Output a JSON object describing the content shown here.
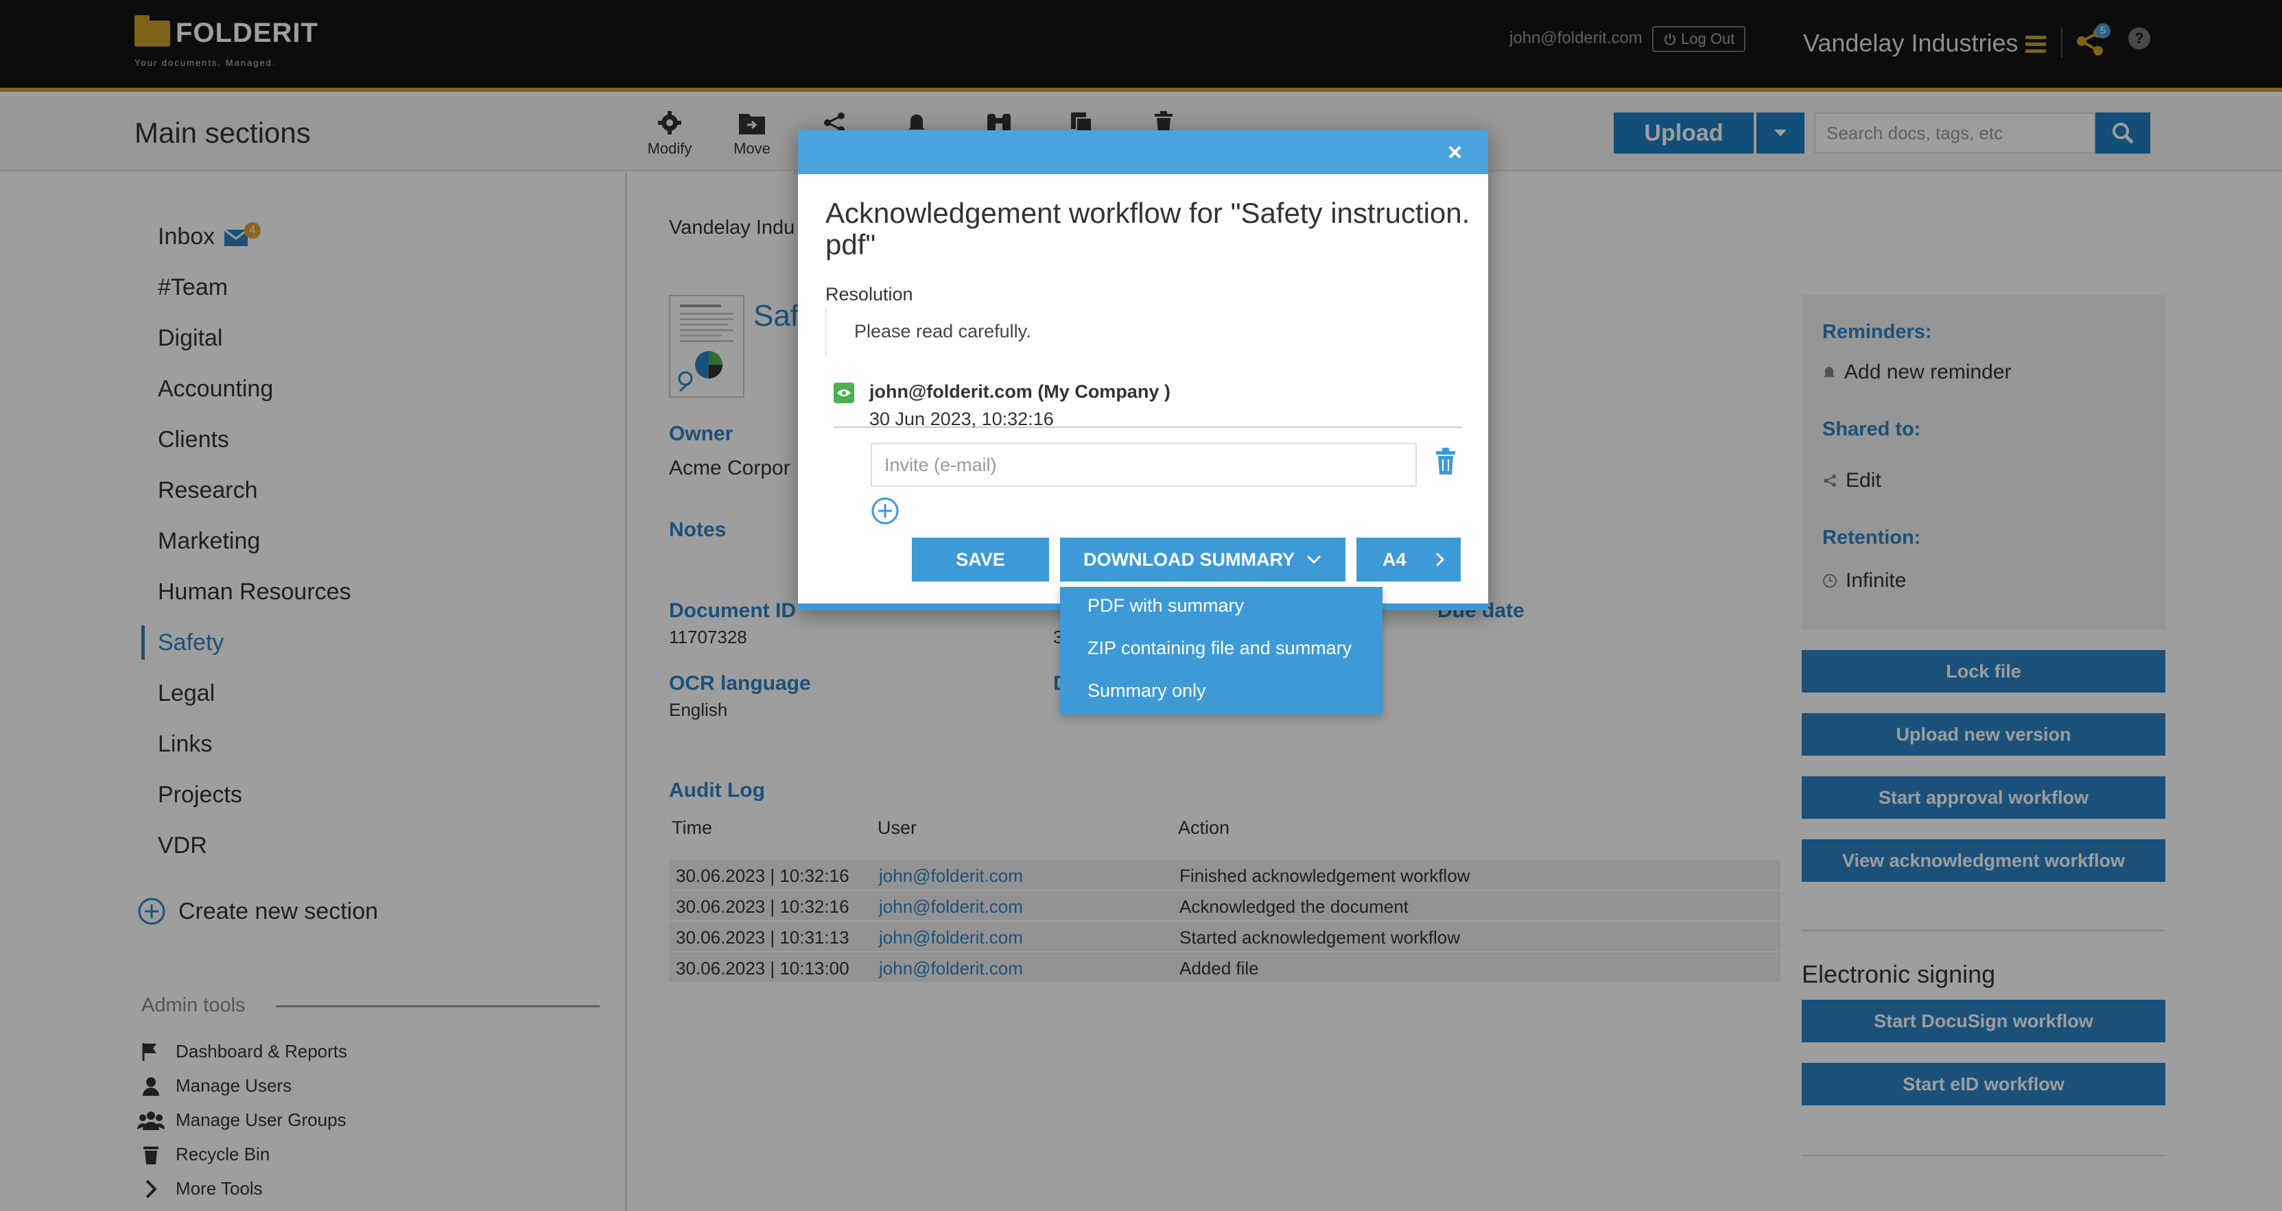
{
  "header": {
    "brand": "FOLDERIT",
    "tagline": "Your documents. Managed.",
    "user_email": "john@folderit.com",
    "logout_label": "Log Out",
    "org_name": "Vandelay Industries",
    "share_count": "5",
    "help_label": "?"
  },
  "toolbar": {
    "section_title": "Main sections",
    "modify_label": "Modify",
    "move_label": "Move",
    "upload_label": "Upload",
    "search_placeholder": "Search docs, tags, etc"
  },
  "sidebar": {
    "items": [
      {
        "label": "Inbox"
      },
      {
        "label": "#Team"
      },
      {
        "label": "Digital"
      },
      {
        "label": "Accounting"
      },
      {
        "label": "Clients"
      },
      {
        "label": "Research"
      },
      {
        "label": "Marketing"
      },
      {
        "label": "Human Resources"
      },
      {
        "label": "Safety"
      },
      {
        "label": "Legal"
      },
      {
        "label": "Links"
      },
      {
        "label": "Projects"
      },
      {
        "label": "VDR"
      }
    ],
    "inbox_count": "4",
    "create_label": "Create new section",
    "admin_title": "Admin tools",
    "admin_items": [
      {
        "label": "Dashboard & Reports"
      },
      {
        "label": "Manage Users"
      },
      {
        "label": "Manage User Groups"
      },
      {
        "label": "Recycle Bin"
      },
      {
        "label": "More Tools"
      }
    ]
  },
  "document": {
    "breadcrumb": "Vandelay Indu",
    "title": "Saf",
    "owner_label": "Owner",
    "owner_value": "Acme Corpor",
    "notes_label": "Notes",
    "docid_label": "Document ID",
    "docid_value": "11707328",
    "col2_partial": "3",
    "duedate_label": "Due date",
    "ocr_label": "OCR language",
    "ocr_value": "English",
    "col2_label_partial": "D"
  },
  "audit": {
    "title": "Audit Log",
    "headers": {
      "time": "Time",
      "user": "User",
      "action": "Action"
    },
    "rows": [
      {
        "time": "30.06.2023 | 10:32:16",
        "user": "john@folderit.com",
        "action": "Finished acknowledgement workflow"
      },
      {
        "time": "30.06.2023 | 10:32:16",
        "user": "john@folderit.com",
        "action": "Acknowledged the document"
      },
      {
        "time": "30.06.2023 | 10:31:13",
        "user": "john@folderit.com",
        "action": "Started acknowledgement workflow"
      },
      {
        "time": "30.06.2023 | 10:13:00",
        "user": "john@folderit.com",
        "action": "Added file"
      }
    ]
  },
  "right_panel": {
    "reminders_label": "Reminders:",
    "add_reminder": "Add new reminder",
    "shared_label": "Shared to:",
    "shared_value": "Edit",
    "retention_label": "Retention:",
    "retention_value": "Infinite",
    "buttons": [
      {
        "label": "Lock file"
      },
      {
        "label": "Upload new version"
      },
      {
        "label": "Start approval workflow"
      },
      {
        "label": "View acknowledgment workflow"
      }
    ],
    "esign_title": "Electronic signing",
    "esign_buttons": [
      {
        "label": "Start DocuSign workflow"
      },
      {
        "label": "Start eID workflow"
      }
    ]
  },
  "modal": {
    "close_label": "×",
    "title": "Acknowledgement workflow for \"Safety instruction.pdf\"",
    "resolution_label": "Resolution",
    "resolution_text": "Please read carefully.",
    "participant_name": "john@folderit.com (My Company )",
    "participant_time": "30 Jun 2023, 10:32:16",
    "invite_placeholder": "Invite (e-mail)",
    "save_label": "SAVE",
    "download_label": "DOWNLOAD SUMMARY",
    "paper_label": "A4",
    "download_options": [
      {
        "label": "PDF with summary"
      },
      {
        "label": "ZIP containing file and summary"
      },
      {
        "label": "Summary only"
      }
    ]
  },
  "colors": {
    "accent": "#2c83c4",
    "modal_header": "#4aa3dc",
    "brand_gold": "#c9a227",
    "success": "#4caf50"
  }
}
